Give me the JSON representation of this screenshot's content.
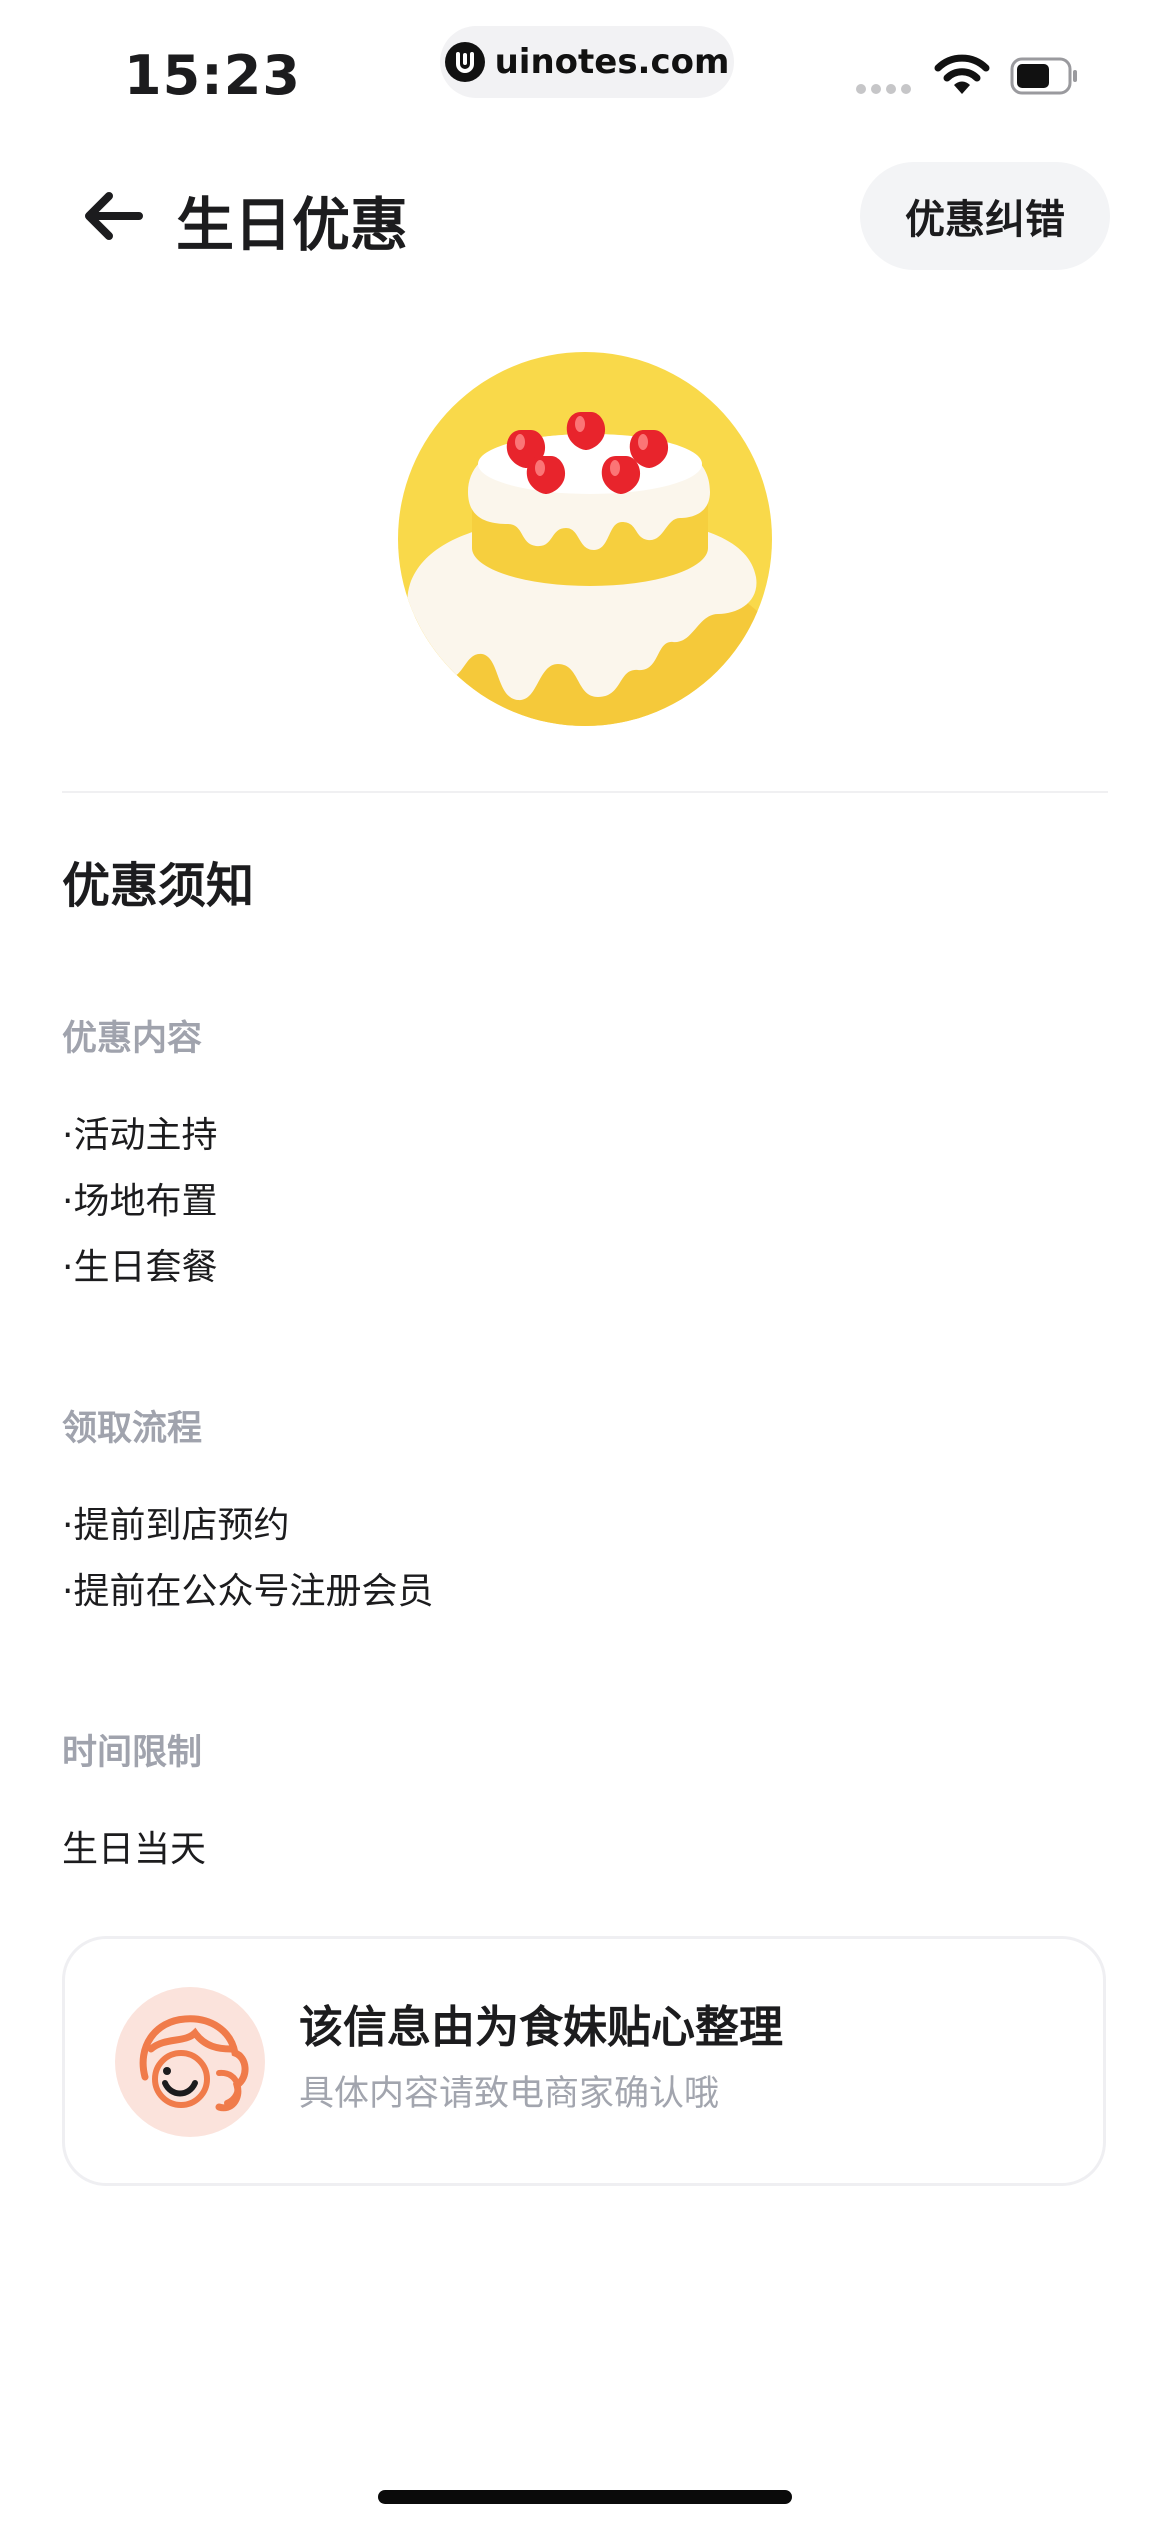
{
  "status_bar": {
    "time": "15:23",
    "url": "uinotes.com"
  },
  "nav": {
    "title": "生日优惠",
    "correction_label": "优惠纠错"
  },
  "hero": {
    "icon": "birthday-cake-icon",
    "background_color": "#f9d94a"
  },
  "notice": {
    "title": "优惠须知",
    "groups": [
      {
        "label": "优惠内容",
        "items": [
          "·活动主持",
          "·场地布置",
          "·生日套餐"
        ]
      },
      {
        "label": "领取流程",
        "items": [
          "·提前到店预约",
          "·提前在公众号注册会员"
        ]
      },
      {
        "label": "时间限制",
        "items": [
          "生日当天"
        ]
      }
    ]
  },
  "info_card": {
    "title": "该信息由为食妹贴心整理",
    "subtitle": "具体内容请致电商家确认哦",
    "avatar_icon": "mascot-girl-icon"
  },
  "colors": {
    "label_gray": "#a0a3ad",
    "pill_bg": "#f3f4f6",
    "cake_yellow": "#f9d94a",
    "strawberry_red": "#e8242c"
  }
}
